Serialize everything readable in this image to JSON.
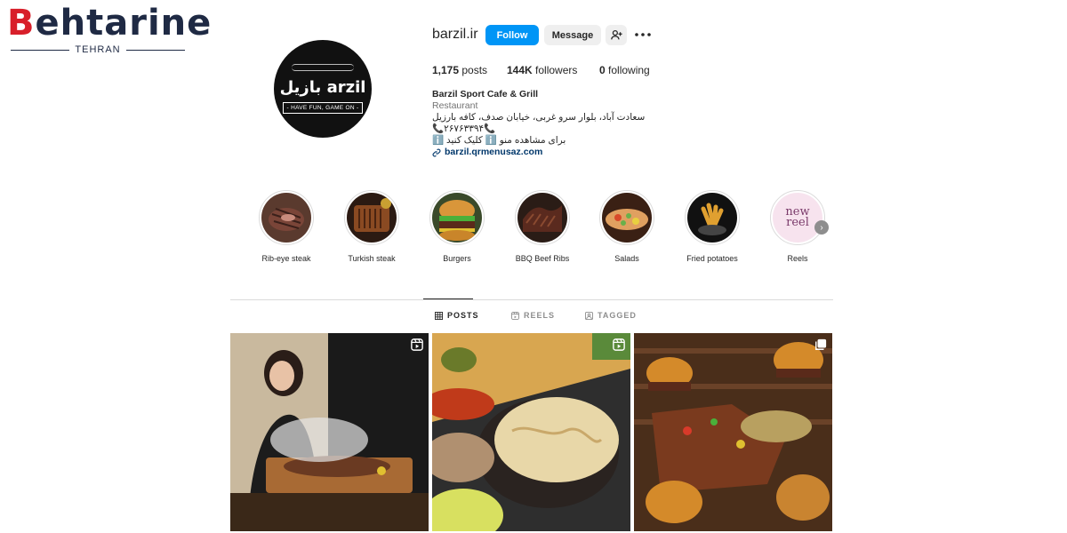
{
  "watermark": {
    "word": "ehtarine",
    "initial": "B",
    "sub": "TEHRAN"
  },
  "avatar": {
    "brand_text": "بازیل arzil",
    "tagline": "- HAVE FUN, GAME ON -"
  },
  "profile": {
    "username": "barzil.ir",
    "follow_label": "Follow",
    "message_label": "Message",
    "posts_count": "1,175",
    "posts_label": "posts",
    "followers_count": "144K",
    "followers_label": "followers",
    "following_count": "0",
    "following_label": "following"
  },
  "bio": {
    "name": "Barzil Sport Cafe & Grill",
    "category": "Restaurant",
    "address": "سعادت آباد، بلوار سرو غربی، خیابان صدف، کافه بارزیل",
    "phone": "📞۲۶۷۶۳۳۹۴📞",
    "menu": "برای مشاهده منو ℹ️ کلیک کنید ℹ️",
    "link": "barzil.qrmenusaz.com"
  },
  "highlights": [
    {
      "label": "Rib-eye steak"
    },
    {
      "label": "Turkish steak"
    },
    {
      "label": "Burgers"
    },
    {
      "label": "BBQ Beef Ribs"
    },
    {
      "label": "Salads"
    },
    {
      "label": "Fried potatoes"
    },
    {
      "label": "Reels",
      "image_text": "new reel"
    }
  ],
  "tabs": [
    {
      "label": "POSTS",
      "icon": "grid-icon",
      "active": true
    },
    {
      "label": "REELS",
      "icon": "reels-icon",
      "active": false
    },
    {
      "label": "TAGGED",
      "icon": "tagged-icon",
      "active": false
    }
  ],
  "posts": [
    {
      "badge": "reel-icon"
    },
    {
      "badge": "reel-icon"
    },
    {
      "badge": "carousel-icon"
    }
  ],
  "colors": {
    "accent": "#0095f6",
    "link": "#00376b",
    "logo_red": "#d81f2a",
    "logo_navy": "#1f2a44"
  }
}
